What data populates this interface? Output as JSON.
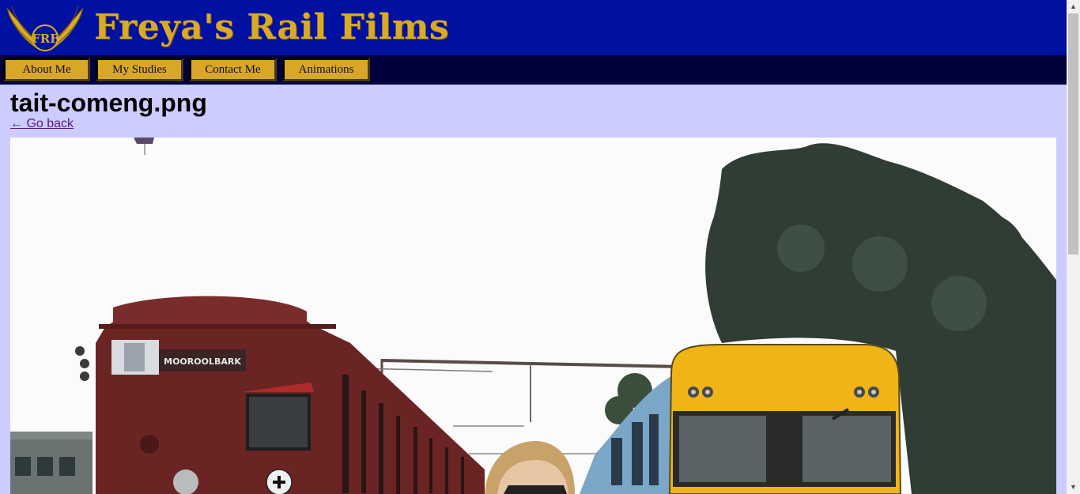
{
  "header": {
    "site_title": "Freya's Rail Films",
    "logo_text": "FRF"
  },
  "nav": {
    "items": [
      {
        "label": "About Me"
      },
      {
        "label": "My Studies"
      },
      {
        "label": "Contact Me"
      },
      {
        "label": "Animations"
      }
    ]
  },
  "main": {
    "file_title": "tait-comeng.png",
    "back_link": "← Go back",
    "photo": {
      "destination_sign": "MOOROOLBARK",
      "alt": "tait-comeng.png"
    }
  },
  "colors": {
    "header_bg": "#0010a0",
    "navbar_bg": "#00003d",
    "brand_gold": "#d9a928",
    "page_bg": "#ccccff",
    "link": "#551a8b"
  }
}
